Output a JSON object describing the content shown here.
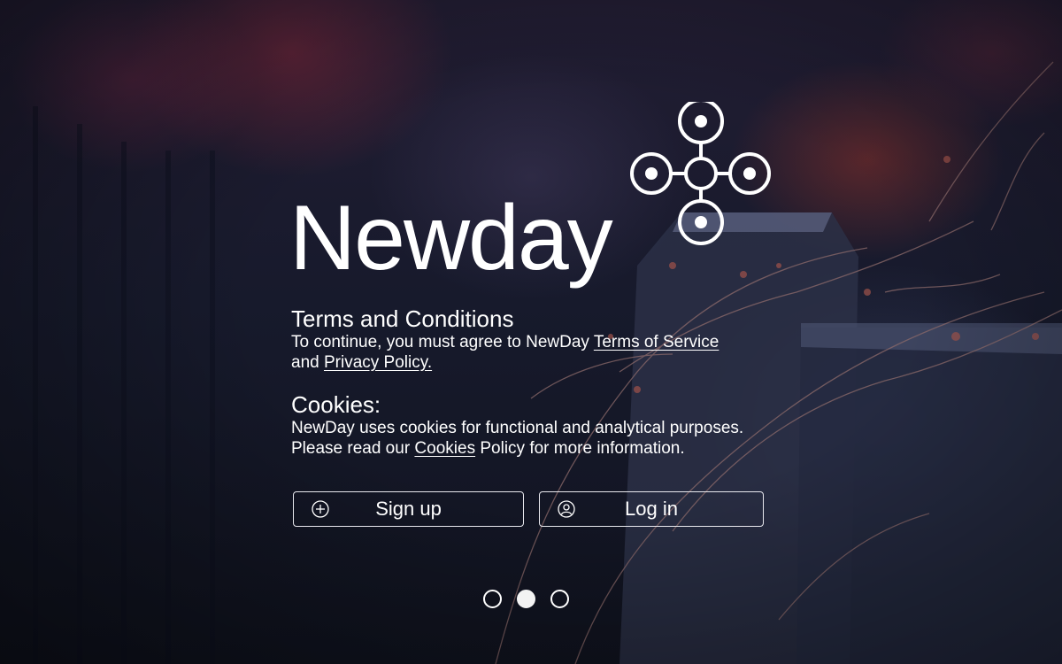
{
  "brand": {
    "name": "Newday"
  },
  "terms": {
    "heading": "Terms and Conditions",
    "line1_prefix": "To continue, you must agree to NewDay ",
    "terms_link": "Terms of Service",
    "line2_prefix": "and ",
    "privacy_link": "Privacy Policy."
  },
  "cookies": {
    "heading": "Cookies:",
    "line1": "NewDay uses cookies for functional and analytical purposes.",
    "line2_prefix": "Please read our ",
    "cookies_link": "Cookies",
    "line2_suffix": " Policy for more information."
  },
  "buttons": {
    "signup": {
      "label": "Sign up",
      "icon": "plus-circle-icon"
    },
    "login": {
      "label": "Log in",
      "icon": "user-circle-icon"
    }
  },
  "pagination": {
    "count": 3,
    "active_index": 1
  },
  "colors": {
    "text": "#ffffff",
    "background": "#171a2c"
  }
}
